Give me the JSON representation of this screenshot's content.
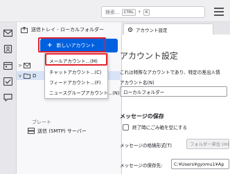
{
  "toolbar": {
    "search_placeholder": "検索...",
    "search_key1": "CTRL",
    "search_key2": "K"
  },
  "folder_pane": {
    "header_label": "送信トレイ - ローカルフォルダー",
    "new_account_label": "新しいアカウント",
    "rows": [
      {
        "label": "",
        "chevron": ">"
      },
      {
        "label": "D",
        "chevron": "v"
      },
      {
        "label": "ブレート",
        "chevron": ""
      },
      {
        "label": "送信 (SMTP) サーバー",
        "chevron": ""
      }
    ]
  },
  "new_account_menu": {
    "items": [
      {
        "label": "メールアカウント...(M)"
      },
      {
        "label": "チャットアカウント...(C)"
      },
      {
        "label": "フィードアカウント...(F)"
      },
      {
        "label": "ニュースグループアカウント...(N)"
      }
    ]
  },
  "settings": {
    "tab_label": "アカウント設定",
    "title": "アカウント設定",
    "description": "これは特殊なアカウントであり、特定の差出人情",
    "account_name_label": "アカウント名(N)",
    "account_name_value": "ローカルフォルダー",
    "message_storage_title": "メッセージの保存",
    "empty_trash_label": "終了時にごみ箱を空にする",
    "storage_format_label": "メッセージの格納形式(T)",
    "storage_format_value": "フォルダー単位 (mb",
    "message_store_label": "メッセージの保存先:",
    "message_store_value": "C:¥Users¥gyomu1¥Ap"
  },
  "colors": {
    "accent": "#0061e0",
    "highlight_outline": "#e0202a"
  },
  "icons": {
    "spaces": [
      "mail-icon",
      "address-book-icon",
      "calendar-icon",
      "tasks-icon",
      "chat-icon"
    ],
    "header": "outbox-icon",
    "tab": "gear-icon",
    "smtp": "server-icon"
  }
}
